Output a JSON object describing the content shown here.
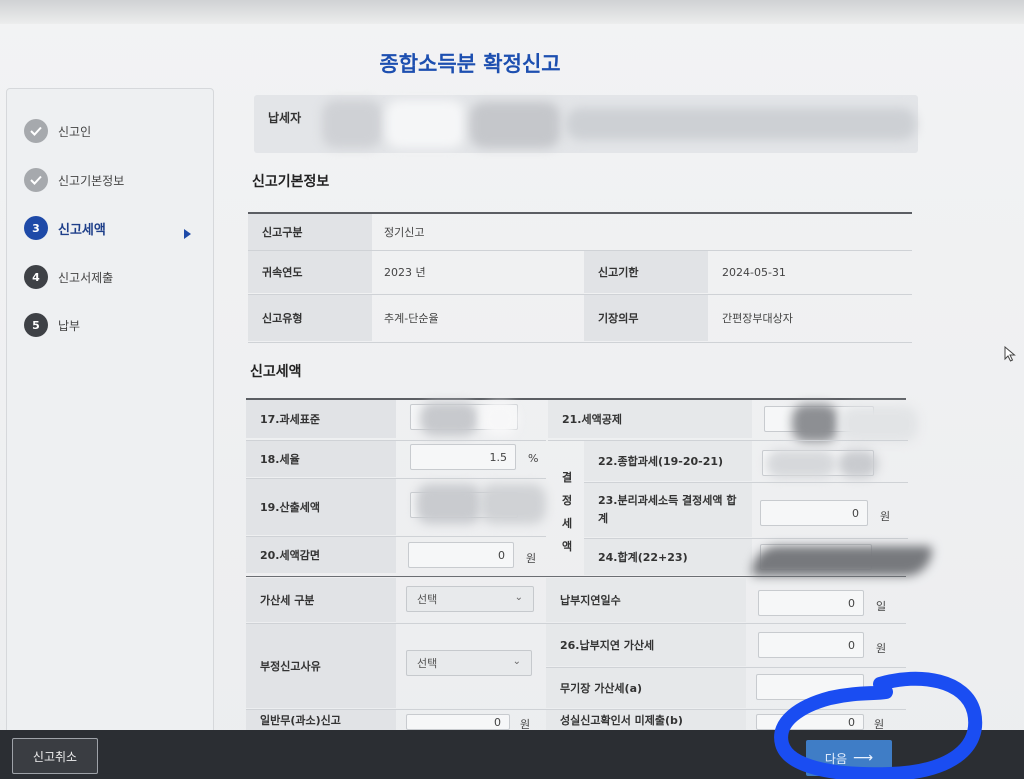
{
  "page": {
    "title": "종합소득분 확정신고"
  },
  "steps": [
    {
      "label": "신고인",
      "status": "done",
      "icon": "check-icon"
    },
    {
      "label": "신고기본정보",
      "status": "done",
      "icon": "check-icon"
    },
    {
      "label": "신고세액",
      "status": "active",
      "number": "3"
    },
    {
      "label": "신고서제출",
      "status": "todo",
      "number": "4"
    },
    {
      "label": "납부",
      "status": "todo",
      "number": "5"
    }
  ],
  "taxpayer": {
    "label": "납세자"
  },
  "basic_info": {
    "section_title": "신고기본정보",
    "report_type_label": "신고구분",
    "report_type_value": "정기신고",
    "year_label": "귀속연도",
    "year_value": "2023 년",
    "deadline_label": "신고기한",
    "deadline_value": "2024-05-31",
    "filing_type_label": "신고유형",
    "filing_type_value": "추계-단순율",
    "bookkeeping_label": "기장의무",
    "bookkeeping_value": "간편장부대상자"
  },
  "tax_amount": {
    "section_title": "신고세액",
    "tax_base_label": "17.과세표준",
    "tax_rate_label": "18.세율",
    "tax_rate_value": "1.5",
    "tax_rate_unit": "%",
    "computed_tax_label": "19.산출세액",
    "tax_reduction_label": "20.세액감면",
    "tax_reduction_value": "0",
    "tax_reduction_unit": "원",
    "tax_credit_label": "21.세액공제",
    "decided_tax_vertical": [
      "결",
      "정",
      "세",
      "액"
    ],
    "global_tax_label": "22.종합과세(19-20-21)",
    "separate_tax_label": "23.분리과세소득 결정세액 합계",
    "separate_tax_value": "0",
    "separate_tax_unit": "원",
    "total_label": "24.합계(22+23)",
    "penalty_type_label": "가산세 구분",
    "penalty_type_value": "선택",
    "late_days_label": "납부지연일수",
    "late_days_value": "0",
    "late_days_unit": "일",
    "fraud_reason_label": "부정신고사유",
    "fraud_reason_value": "선택",
    "late_penalty_label": "26.납부지연 가산세",
    "late_penalty_value": "0",
    "late_penalty_unit": "원",
    "no_book_penalty_label": "무기장 가산세(a)",
    "general_report_label": "일반무(과소)신고",
    "general_report_value": "0",
    "general_report_unit": "원",
    "sincere_report_label": "성실신고확인서 미제출(b)",
    "sincere_report_value": "0",
    "sincere_report_unit": "원"
  },
  "footer": {
    "cancel_label": "신고취소",
    "next_label": "다음"
  }
}
